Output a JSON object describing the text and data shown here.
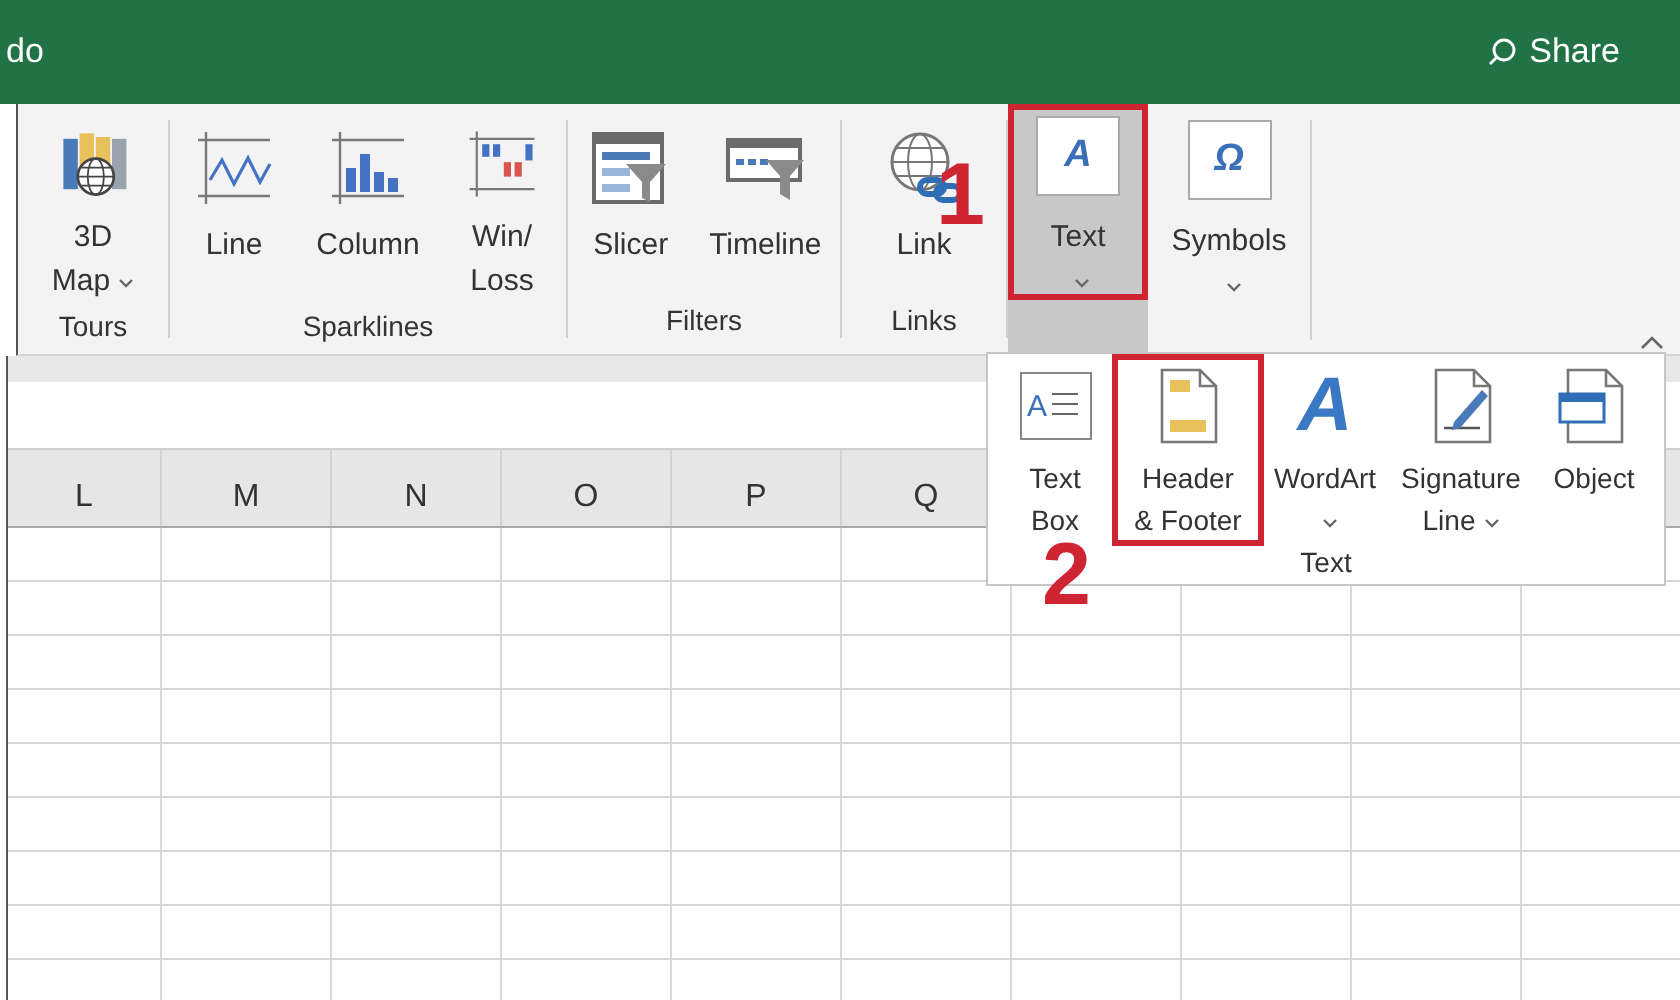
{
  "window": {
    "title": "do",
    "share": "Share"
  },
  "ribbon": {
    "groups": [
      {
        "label": "Tours",
        "buttons": [
          {
            "kind": "map3d",
            "lines": [
              "3D",
              "Map"
            ],
            "dropdown": true,
            "selected": false,
            "highlighted": false
          }
        ]
      },
      {
        "label": "Sparklines",
        "buttons": [
          {
            "kind": "line",
            "lines": [
              "Line"
            ],
            "dropdown": false,
            "selected": false,
            "highlighted": false
          },
          {
            "kind": "column",
            "lines": [
              "Column"
            ],
            "dropdown": false,
            "selected": false,
            "highlighted": false
          },
          {
            "kind": "winloss",
            "lines": [
              "Win/",
              "Loss"
            ],
            "dropdown": false,
            "selected": false,
            "highlighted": false
          }
        ]
      },
      {
        "label": "Filters",
        "buttons": [
          {
            "kind": "slicer",
            "lines": [
              "Slicer"
            ],
            "dropdown": false,
            "selected": false,
            "highlighted": false
          },
          {
            "kind": "timeline",
            "lines": [
              "Timeline"
            ],
            "dropdown": false,
            "selected": false,
            "highlighted": false
          }
        ]
      },
      {
        "label": "Links",
        "buttons": [
          {
            "kind": "link",
            "lines": [
              "Link"
            ],
            "dropdown": false,
            "selected": false,
            "highlighted": false
          }
        ]
      },
      {
        "buttons": [
          {
            "kind": "glyph",
            "glyph": "A",
            "lines": [
              "Text"
            ],
            "dropdown": true,
            "selected": true,
            "highlighted": true
          },
          {
            "kind": "glyph",
            "glyph": "Ω",
            "lines": [
              "Symbols"
            ],
            "dropdown": true,
            "selected": false,
            "highlighted": false
          }
        ]
      }
    ]
  },
  "text_menu": {
    "label": "Text",
    "items": [
      {
        "kind": "textbox",
        "glyph": "A",
        "lines": [
          "Text",
          "Box"
        ],
        "dropdown": false,
        "highlighted": false
      },
      {
        "kind": "headerfooter",
        "lines": [
          "Header",
          "& Footer"
        ],
        "dropdown": false,
        "highlighted": true
      },
      {
        "kind": "wordart",
        "glyph": "A",
        "lines": [
          "WordArt"
        ],
        "dropdown": true,
        "highlighted": false
      },
      {
        "kind": "signature",
        "lines": [
          "Signature",
          "Line"
        ],
        "dropdown": true,
        "highlighted": false
      },
      {
        "kind": "object",
        "lines": [
          "Object"
        ],
        "dropdown": false,
        "highlighted": false
      }
    ]
  },
  "sheet": {
    "columns": [
      "L",
      "M",
      "N",
      "O",
      "P",
      "Q"
    ]
  },
  "annotations": [
    {
      "label": "1"
    },
    {
      "label": "2"
    }
  ]
}
